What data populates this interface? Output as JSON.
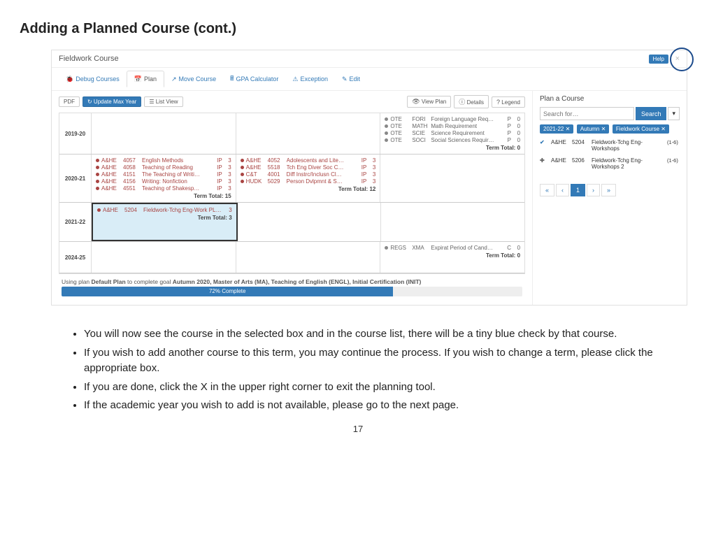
{
  "title": "Adding a Planned Course (cont.)",
  "header": {
    "title": "Fieldwork Course",
    "help": "Help",
    "close": "×"
  },
  "tabs": [
    {
      "icon": "🐞",
      "label": "Debug Courses"
    },
    {
      "icon": "📅",
      "label": "Plan"
    },
    {
      "icon": "↗",
      "label": "Move Course"
    },
    {
      "icon": "🖩",
      "label": "GPA Calculator"
    },
    {
      "icon": "⚠",
      "label": "Exception"
    },
    {
      "icon": "✎",
      "label": "Edit"
    }
  ],
  "toolbar_left": {
    "pdf": "PDF",
    "refresh": "↻ Update Max Year",
    "listview": "☰ List View"
  },
  "toolbar_right": [
    {
      "icon": "👁",
      "label": "View Plan"
    },
    {
      "icon": "ⓘ",
      "label": "Details"
    },
    {
      "icon": "?",
      "label": "Legend"
    }
  ],
  "years": {
    "y1920": {
      "label": "2019-20",
      "col3_courses": [
        {
          "dept": "OTE",
          "num": "FORI",
          "title": "Foreign Language Req…",
          "stat": "P",
          "cr": "0"
        },
        {
          "dept": "OTE",
          "num": "MATH",
          "title": "Math Requirement",
          "stat": "P",
          "cr": "0"
        },
        {
          "dept": "OTE",
          "num": "SCIE",
          "title": "Science Requirement",
          "stat": "P",
          "cr": "0"
        },
        {
          "dept": "OTE",
          "num": "SOCI",
          "title": "Social Sciences Requir…",
          "stat": "P",
          "cr": "0"
        }
      ],
      "col3_total": "Term Total:  0"
    },
    "y2021": {
      "label": "2020-21",
      "col1_courses": [
        {
          "dept": "A&HE",
          "num": "4057",
          "title": "English Methods",
          "stat": "IP",
          "cr": "3"
        },
        {
          "dept": "A&HE",
          "num": "4058",
          "title": "Teaching of Reading",
          "stat": "IP",
          "cr": "3"
        },
        {
          "dept": "A&HE",
          "num": "4151",
          "title": "The Teaching of Writi…",
          "stat": "IP",
          "cr": "3"
        },
        {
          "dept": "A&HE",
          "num": "4156",
          "title": "Writing: Nonfiction",
          "stat": "IP",
          "cr": "3"
        },
        {
          "dept": "A&HE",
          "num": "4551",
          "title": "Teaching of Shakesp…",
          "stat": "IP",
          "cr": "3"
        }
      ],
      "col1_total": "Term Total:  15",
      "col2_courses": [
        {
          "dept": "A&HE",
          "num": "4052",
          "title": "Adolescents and Lite…",
          "stat": "IP",
          "cr": "3"
        },
        {
          "dept": "A&HE",
          "num": "5518",
          "title": "Tch Eng Diver Soc C…",
          "stat": "IP",
          "cr": "3"
        },
        {
          "dept": "C&T",
          "num": "4001",
          "title": "Diff Instrc/Inclusn Cl…",
          "stat": "IP",
          "cr": "3"
        },
        {
          "dept": "HUDK",
          "num": "5029",
          "title": "Person Dvlpmnt & S…",
          "stat": "IP",
          "cr": "3"
        }
      ],
      "col2_total": "Term Total:  12"
    },
    "y2122": {
      "label": "2021-22",
      "sel_course": {
        "dept": "A&HE",
        "num": "5204",
        "title": "Fieldwork-Tchg Eng-Work PL…",
        "stat": "",
        "cr": "3"
      },
      "sel_total": "Term Total:  3"
    },
    "y2425": {
      "label": "2024-25",
      "col3_course": {
        "dept": "REGS",
        "num": "XMA",
        "title": "Expirat Period of Cand…",
        "stat": "C",
        "cr": "0"
      },
      "col3_total": "Term Total:  0"
    }
  },
  "footer": {
    "text_pre": "Using plan ",
    "plan_name": "Default Plan",
    "text_mid": " to complete goal ",
    "goal": "Autumn 2020, Master of Arts (MA), Teaching of English (ENGL), Initial Certification (INIT)",
    "progress_label": "72% Complete",
    "progress_pct": 72
  },
  "right_panel": {
    "heading": "Plan a Course",
    "search_placeholder": "Search for…",
    "search_btn": "Search",
    "caret": "▾",
    "pills": [
      "2021-22 ✕",
      "Autumn ✕",
      "Fieldwork Course ✕"
    ],
    "results": [
      {
        "icon": "check",
        "dept": "A&HE",
        "num": "5204",
        "title": "Fieldwork-Tchg Eng-Workshops",
        "cr": "(1-6)"
      },
      {
        "icon": "plus",
        "dept": "A&HE",
        "num": "5206",
        "title": "Fieldwork-Tchg Eng-Workshops 2",
        "cr": "(1-6)"
      }
    ],
    "pager": [
      "«",
      "‹",
      "1",
      "›",
      "»"
    ]
  },
  "instructions": [
    "You will now see the course in the selected box and in the course list, there will be a tiny blue check by that course.",
    "If you wish to add another course to this term, you may continue the process. If you wish to change a term, please click the appropriate box.",
    "If you are done, click the X in the upper right corner to exit the planning tool.",
    "If the academic year you wish to add is not available, please go to the next page."
  ],
  "page_number": "17"
}
